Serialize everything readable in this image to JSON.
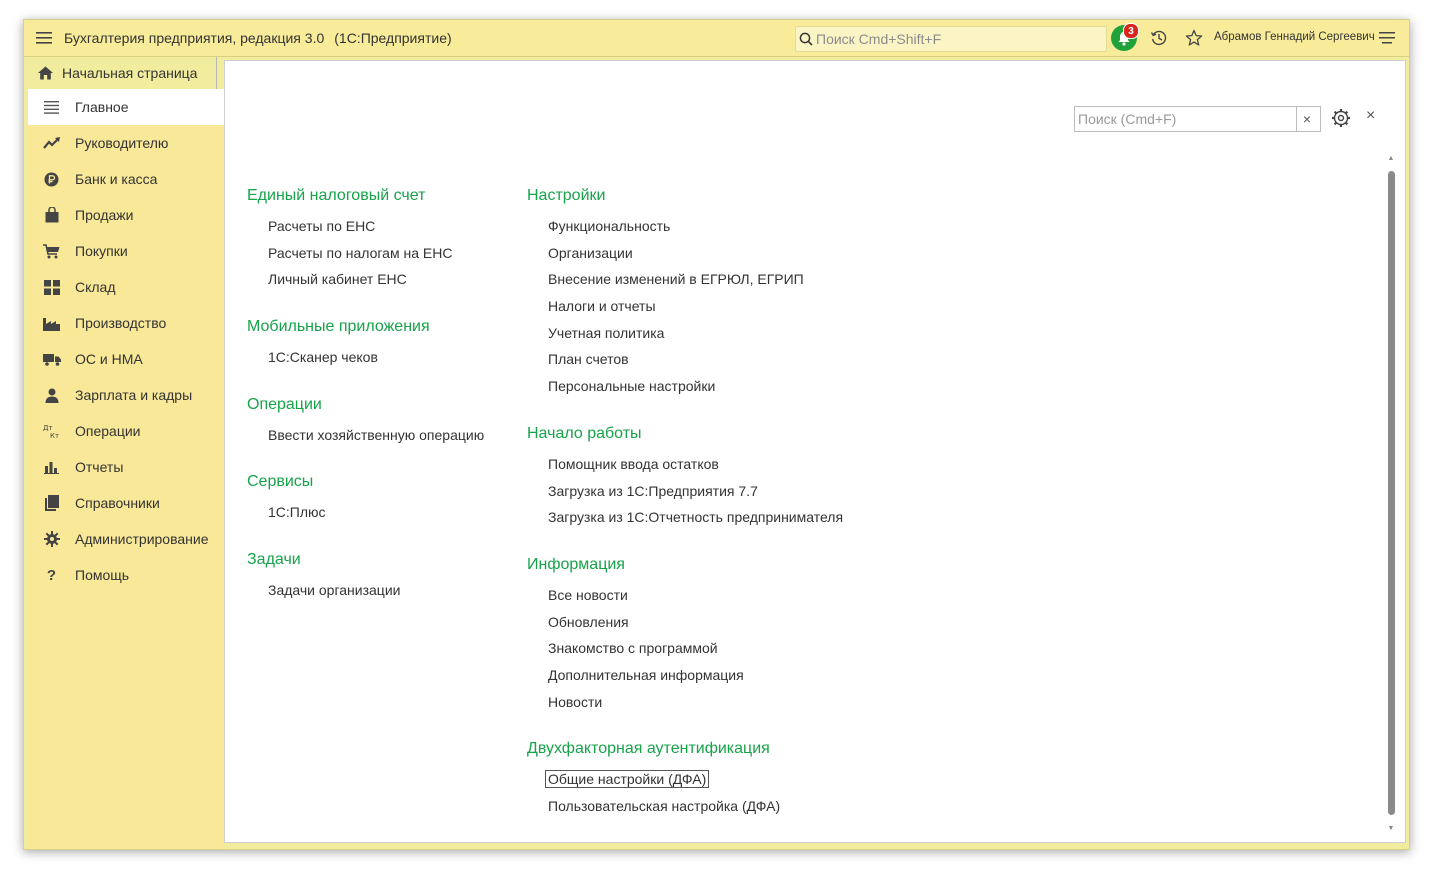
{
  "app": {
    "title": "Бухгалтерия предприятия, редакция 3.0",
    "subtitle": "(1С:Предприятие)"
  },
  "topbar": {
    "search_placeholder": "Поиск Cmd+Shift+F",
    "notification_count": "3",
    "user_name": "Абрамов Геннадий Сергеевич"
  },
  "home_tab": {
    "label": "Начальная страница"
  },
  "sidebar": {
    "items": [
      {
        "label": "Главное",
        "icon": "menu-lines-icon",
        "active": true
      },
      {
        "label": "Руководителю",
        "icon": "trend-icon"
      },
      {
        "label": "Банк и касса",
        "icon": "ruble-icon"
      },
      {
        "label": "Продажи",
        "icon": "shopping-bag-icon"
      },
      {
        "label": "Покупки",
        "icon": "cart-icon"
      },
      {
        "label": "Склад",
        "icon": "warehouse-icon"
      },
      {
        "label": "Производство",
        "icon": "factory-icon"
      },
      {
        "label": "ОС и НМА",
        "icon": "truck-icon"
      },
      {
        "label": "Зарплата и кадры",
        "icon": "person-icon"
      },
      {
        "label": "Операции",
        "icon": "dt-kt-icon"
      },
      {
        "label": "Отчеты",
        "icon": "bar-chart-icon"
      },
      {
        "label": "Справочники",
        "icon": "books-icon"
      },
      {
        "label": "Администрирование",
        "icon": "gear-icon"
      },
      {
        "label": "Помощь",
        "icon": "question-icon"
      }
    ]
  },
  "content": {
    "search_placeholder": "Поиск (Cmd+F)",
    "clear_label": "×",
    "close_label": "×",
    "left_column": [
      {
        "title": "Единый налоговый счет",
        "items": [
          "Расчеты по ЕНС",
          "Расчеты по налогам на ЕНС",
          "Личный кабинет ЕНС"
        ]
      },
      {
        "title": "Мобильные приложения",
        "items": [
          "1С:Сканер чеков"
        ]
      },
      {
        "title": "Операции",
        "items": [
          "Ввести хозяйственную операцию"
        ]
      },
      {
        "title": "Сервисы",
        "items": [
          "1С:Плюс"
        ]
      },
      {
        "title": "Задачи",
        "items": [
          "Задачи организации"
        ]
      }
    ],
    "right_column": [
      {
        "title": "Настройки",
        "items": [
          "Функциональность",
          "Организации",
          "Внесение изменений в ЕГРЮЛ, ЕГРИП",
          "Налоги и отчеты",
          "Учетная политика",
          "План счетов",
          "Персональные настройки"
        ]
      },
      {
        "title": "Начало работы",
        "items": [
          "Помощник ввода остатков",
          "Загрузка из 1С:Предприятия 7.7",
          "Загрузка из 1С:Отчетность предпринимателя"
        ]
      },
      {
        "title": "Информация",
        "items": [
          "Все новости",
          "Обновления",
          "Знакомство с программой",
          "Дополнительная информация",
          "Новости"
        ]
      },
      {
        "title": "Двухфакторная аутентификация",
        "items": [
          "Общие настройки (ДФА)",
          "Пользовательская настройка (ДФА)"
        ]
      }
    ]
  },
  "colors": {
    "accent_green": "#17a34a",
    "sidebar_bg": "#f8e898",
    "topbar_bg": "#f8ec9b",
    "badge_red": "#d9261c"
  }
}
